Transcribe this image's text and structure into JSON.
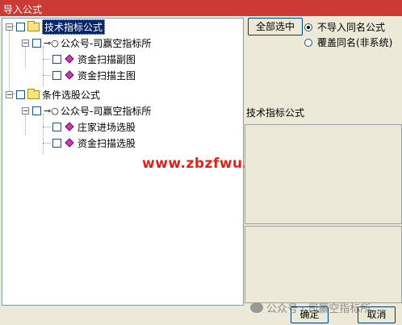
{
  "window": {
    "title": "导入公式"
  },
  "tree": {
    "root1": {
      "label": "技术指标公式",
      "child": {
        "label": "公众号-司赢空指标所",
        "items": [
          "资金扫描副图",
          "资金扫描主图"
        ]
      }
    },
    "root2": {
      "label": "条件选股公式",
      "child": {
        "label": "公众号-司赢空指标所",
        "items": [
          "庄家进场选股",
          "资金扫描选股"
        ]
      }
    }
  },
  "controls": {
    "select_all": "全部选中",
    "radio1": "不导入同名公式",
    "radio2": "覆盖同名(非系统)",
    "desc_label": "技术指标公式",
    "ok": "确定",
    "cancel": "取消"
  },
  "watermark": {
    "site": "www.zbzfwu.com",
    "wechat": "公众号 · 司赢空指标所"
  }
}
